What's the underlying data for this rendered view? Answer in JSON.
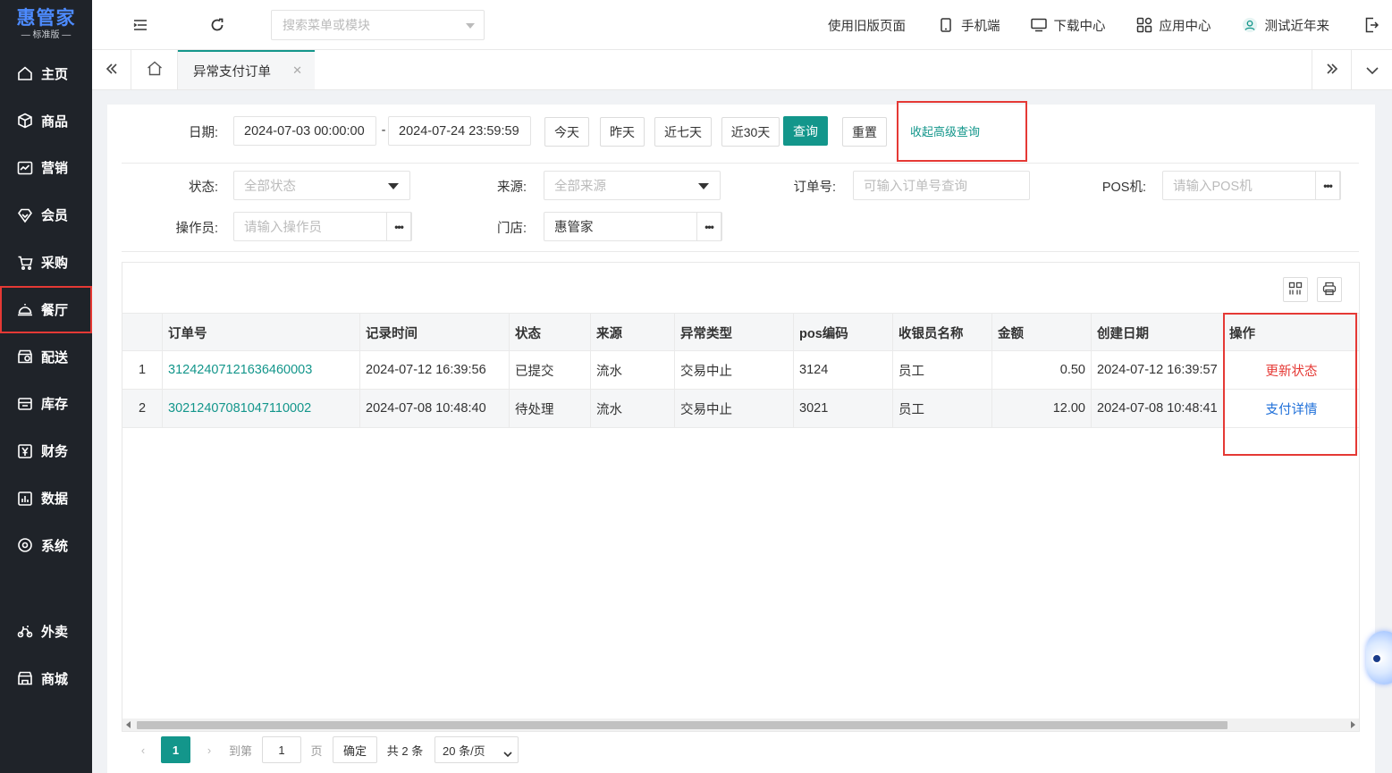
{
  "app": {
    "brand": "惠管家",
    "edition": "— 标准版 —"
  },
  "sidebar": {
    "items": [
      {
        "label": "主页",
        "icon": "home-icon"
      },
      {
        "label": "商品",
        "icon": "box-icon"
      },
      {
        "label": "营销",
        "icon": "chart-line-icon"
      },
      {
        "label": "会员",
        "icon": "diamond-icon"
      },
      {
        "label": "采购",
        "icon": "cart-icon"
      },
      {
        "label": "餐厅",
        "icon": "cloche-icon",
        "active": true
      },
      {
        "label": "配送",
        "icon": "store-icon"
      },
      {
        "label": "库存",
        "icon": "warehouse-icon"
      },
      {
        "label": "财务",
        "icon": "yen-icon"
      },
      {
        "label": "数据",
        "icon": "bar-chart-icon"
      },
      {
        "label": "系统",
        "icon": "gear-icon"
      }
    ],
    "bottom_items": [
      {
        "label": "外卖",
        "icon": "bike-icon"
      },
      {
        "label": "商城",
        "icon": "shop-icon"
      }
    ]
  },
  "header": {
    "search_placeholder": "搜索菜单或模块",
    "links": {
      "old_page": "使用旧版页面",
      "mobile": "手机端",
      "download": "下载中心",
      "apps": "应用中心",
      "user": "测试近年来"
    }
  },
  "tabs": {
    "active": "异常支付订单"
  },
  "filters": {
    "date_label": "日期:",
    "date_start": "2024-07-03 00:00:00",
    "date_sep": "-",
    "date_end": "2024-07-24 23:59:59",
    "quick": [
      "今天",
      "昨天",
      "近七天",
      "近30天"
    ],
    "query_btn": "查询",
    "reset_btn": "重置",
    "advanced_link": "收起高级查询",
    "status_label": "状态:",
    "status_placeholder": "全部状态",
    "source_label": "来源:",
    "source_placeholder": "全部来源",
    "order_label": "订单号:",
    "order_placeholder": "可输入订单号查询",
    "pos_label": "POS机:",
    "pos_placeholder": "请输入POS机",
    "operator_label": "操作员:",
    "operator_placeholder": "请输入操作员",
    "store_label": "门店:",
    "store_value": "惠管家",
    "more": "•••"
  },
  "table": {
    "columns": [
      "订单号",
      "记录时间",
      "状态",
      "来源",
      "异常类型",
      "pos编码",
      "收银员名称",
      "金额",
      "创建日期",
      "操作"
    ],
    "rows": [
      {
        "idx": "1",
        "order": "31242407121636460003",
        "time": "2024-07-12 16:39:56",
        "status": "已提交",
        "source": "流水",
        "type": "交易中止",
        "pos": "3124",
        "cashier": "员工",
        "amount": "0.50",
        "created": "2024-07-12 16:39:57",
        "action": "更新状态",
        "action_color": "#e53935"
      },
      {
        "idx": "2",
        "order": "30212407081047110002",
        "time": "2024-07-08 10:48:40",
        "status": "待处理",
        "source": "流水",
        "type": "交易中止",
        "pos": "3021",
        "cashier": "员工",
        "amount": "12.00",
        "created": "2024-07-08 10:48:41",
        "action": "支付详情",
        "action_color": "#1e6fd9"
      }
    ]
  },
  "pager": {
    "current": "1",
    "goto_label": "到第",
    "goto_value": "1",
    "page_unit": "页",
    "confirm": "确定",
    "total": "共 2 条",
    "page_size": "20 条/页"
  },
  "colors": {
    "primary": "#13968b",
    "sidebar_bg": "#1f2329",
    "highlight": "#e53935"
  }
}
